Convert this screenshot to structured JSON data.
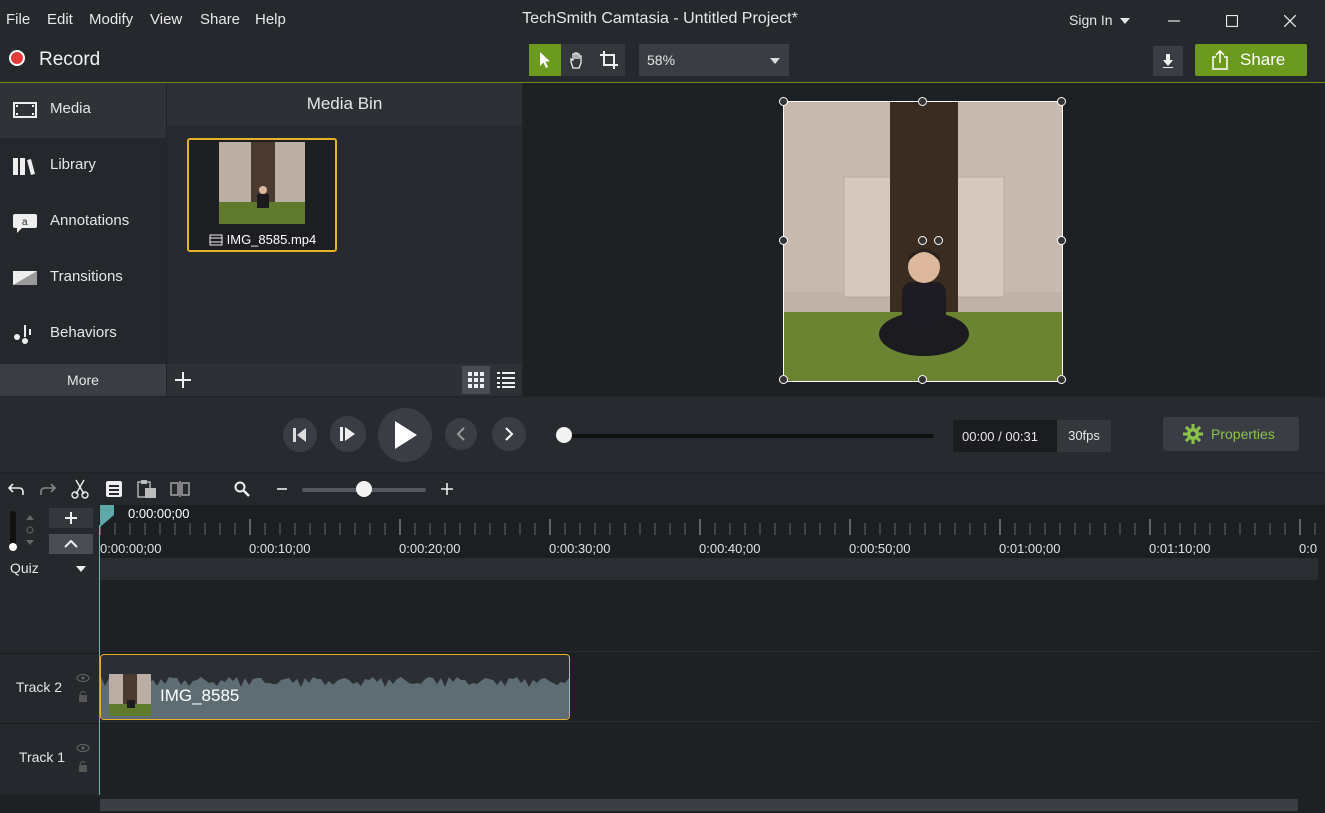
{
  "window": {
    "title": "TechSmith Camtasia - Untitled Project*",
    "menu": [
      "File",
      "Edit",
      "Modify",
      "View",
      "Share",
      "Help"
    ],
    "sign_in": "Sign In"
  },
  "toolbar": {
    "record_label": "Record",
    "zoom_value": "58%",
    "share_label": "Share"
  },
  "left_tabs": {
    "items": [
      "Media",
      "Library",
      "Annotations",
      "Transitions",
      "Behaviors"
    ],
    "more_label": "More",
    "active": "Media"
  },
  "media_bin": {
    "title": "Media Bin",
    "items": [
      {
        "name": "IMG_8585.mp4"
      }
    ]
  },
  "playback": {
    "time_current": "00:00",
    "time_separator": "/",
    "time_total": "00:31",
    "fps": "30fps",
    "properties_label": "Properties"
  },
  "timeline": {
    "playhead_time": "0:00:00;00",
    "ruler_labels": [
      "0:00:00;00",
      "0:00:10;00",
      "0:00:20;00",
      "0:00:30;00",
      "0:00:40;00",
      "0:00:50;00",
      "0:01:00;00",
      "0:01:10;00",
      "0:0"
    ],
    "quiz_label": "Quiz",
    "tracks": [
      {
        "name": "Track 2",
        "clip": "IMG_8585"
      },
      {
        "name": "Track 1",
        "clip": ""
      }
    ]
  },
  "colors": {
    "accent_green": "#6c9a1f",
    "selection_gold": "#e8b227",
    "record_red": "#e63b3b",
    "annotation_arrow": "#e21b1b"
  }
}
